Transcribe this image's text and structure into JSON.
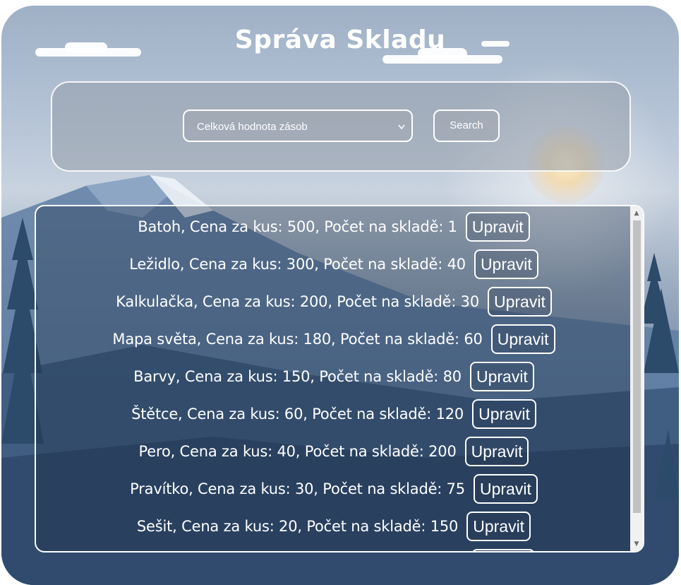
{
  "header": {
    "title": "Správa Skladu"
  },
  "search": {
    "selected_option": "Celková hodnota zásob",
    "search_label": "Search"
  },
  "inventory": {
    "edit_label": "Upravit",
    "items": [
      {
        "text": "Batoh, Cena za kus: 500, Počet na skladě: 1"
      },
      {
        "text": "Ležidlo, Cena za kus: 300, Počet na skladě: 40"
      },
      {
        "text": "Kalkulačka, Cena za kus: 200, Počet na skladě: 30"
      },
      {
        "text": "Mapa světa, Cena za kus: 180, Počet na skladě: 60"
      },
      {
        "text": "Barvy, Cena za kus: 150, Počet na skladě: 80"
      },
      {
        "text": "Štětce, Cena za kus: 60, Počet na skladě: 120"
      },
      {
        "text": "Pero, Cena za kus: 40, Počet na skladě: 200"
      },
      {
        "text": "Pravítko, Cena za kus: 30, Počet na skladě: 75"
      },
      {
        "text": "Sešit, Cena za kus: 20, Počet na skladě: 150"
      }
    ]
  },
  "icons": {
    "select_chevron": "chevron-down-icon",
    "scroll_up": "scroll-up-arrow-icon",
    "scroll_down": "scroll-down-arrow-icon"
  },
  "colors": {
    "text": "#ffffff",
    "border": "#ffffff"
  }
}
